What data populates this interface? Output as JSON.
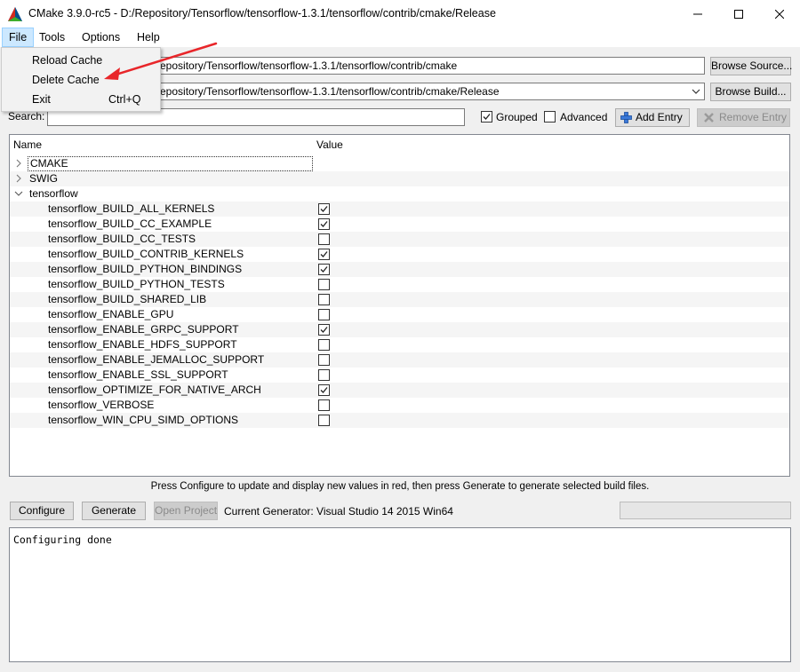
{
  "window": {
    "title": "CMake 3.9.0-rc5 - D:/Repository/Tensorflow/tensorflow-1.3.1/tensorflow/contrib/cmake/Release"
  },
  "menu": {
    "items": [
      "File",
      "Tools",
      "Options",
      "Help"
    ],
    "file_dropdown": [
      {
        "label": "Reload Cache",
        "shortcut": ""
      },
      {
        "label": "Delete Cache",
        "shortcut": ""
      },
      {
        "label": "Exit",
        "shortcut": "Ctrl+Q"
      }
    ]
  },
  "source": {
    "visible_value": "epository/Tensorflow/tensorflow-1.3.1/tensorflow/contrib/cmake",
    "browse_label": "Browse Source..."
  },
  "build": {
    "visible_value": "epository/Tensorflow/tensorflow-1.3.1/tensorflow/contrib/cmake/Release",
    "browse_label": "Browse Build..."
  },
  "search": {
    "label": "Search:",
    "value": ""
  },
  "options": {
    "grouped_label": "Grouped",
    "grouped_checked": true,
    "advanced_label": "Advanced",
    "advanced_checked": false,
    "add_entry_label": "Add Entry",
    "remove_entry_label": "Remove Entry"
  },
  "tree": {
    "headers": {
      "name": "Name",
      "value": "Value"
    },
    "groups": [
      {
        "label": "CMAKE",
        "expanded": false,
        "selected": true
      },
      {
        "label": "SWIG",
        "expanded": false
      },
      {
        "label": "tensorflow",
        "expanded": true
      }
    ],
    "entries": [
      {
        "name": "tensorflow_BUILD_ALL_KERNELS",
        "checked": true
      },
      {
        "name": "tensorflow_BUILD_CC_EXAMPLE",
        "checked": true
      },
      {
        "name": "tensorflow_BUILD_CC_TESTS",
        "checked": false
      },
      {
        "name": "tensorflow_BUILD_CONTRIB_KERNELS",
        "checked": true
      },
      {
        "name": "tensorflow_BUILD_PYTHON_BINDINGS",
        "checked": true
      },
      {
        "name": "tensorflow_BUILD_PYTHON_TESTS",
        "checked": false
      },
      {
        "name": "tensorflow_BUILD_SHARED_LIB",
        "checked": false
      },
      {
        "name": "tensorflow_ENABLE_GPU",
        "checked": false
      },
      {
        "name": "tensorflow_ENABLE_GRPC_SUPPORT",
        "checked": true
      },
      {
        "name": "tensorflow_ENABLE_HDFS_SUPPORT",
        "checked": false
      },
      {
        "name": "tensorflow_ENABLE_JEMALLOC_SUPPORT",
        "checked": false
      },
      {
        "name": "tensorflow_ENABLE_SSL_SUPPORT",
        "checked": false
      },
      {
        "name": "tensorflow_OPTIMIZE_FOR_NATIVE_ARCH",
        "checked": true
      },
      {
        "name": "tensorflow_VERBOSE",
        "checked": false
      },
      {
        "name": "tensorflow_WIN_CPU_SIMD_OPTIONS",
        "checked": false
      }
    ]
  },
  "hint": "Press Configure to update and display new values in red, then press Generate to generate selected build files.",
  "actions": {
    "configure_label": "Configure",
    "generate_label": "Generate",
    "open_project_label": "Open Project",
    "generator_text": "Current Generator: Visual Studio 14 2015 Win64"
  },
  "output": {
    "text": "Configuring done"
  },
  "colors": {
    "annotation_arrow": "#e8262a",
    "menu_highlight": "#cce8ff"
  }
}
